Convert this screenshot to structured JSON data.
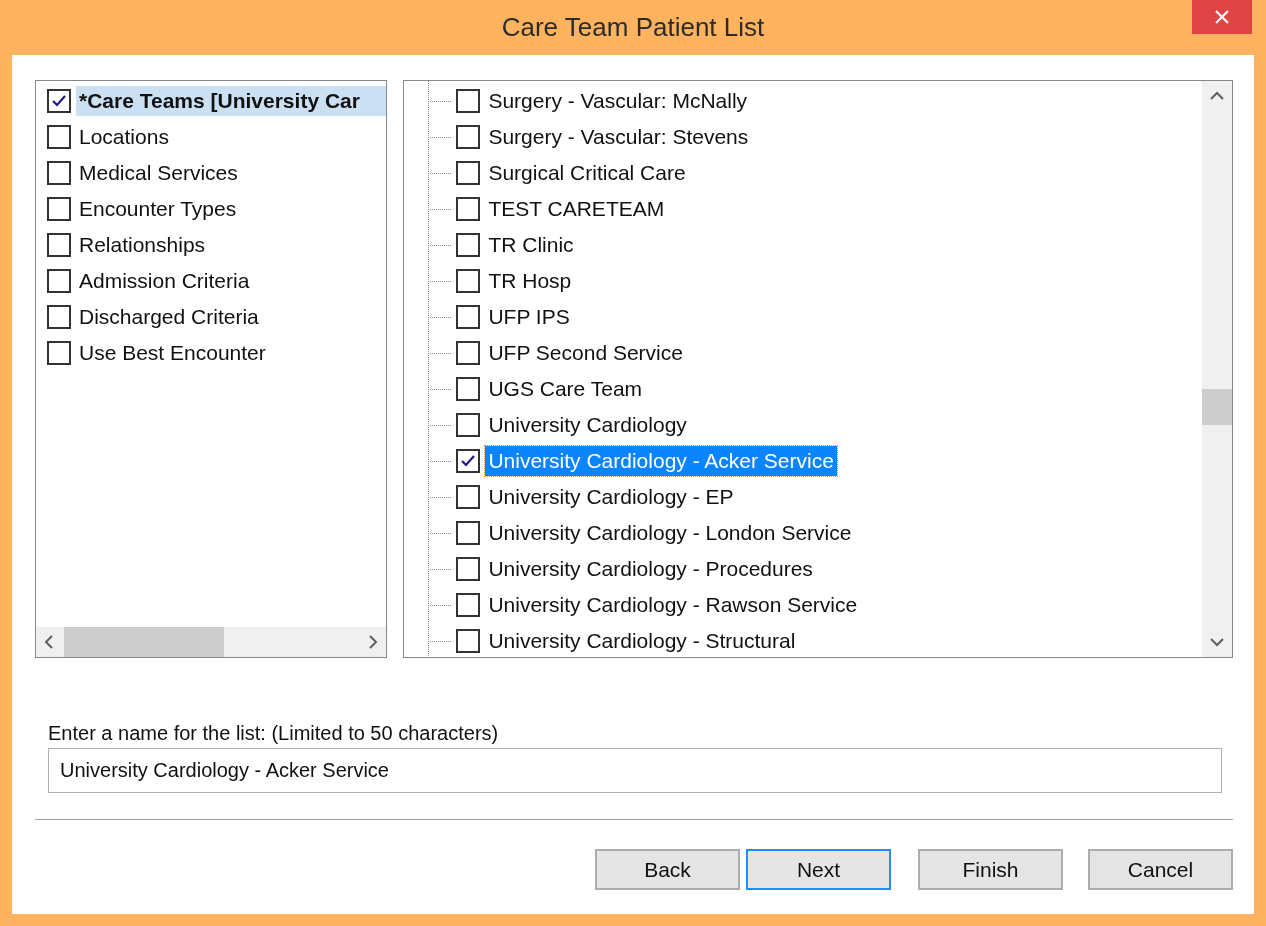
{
  "window": {
    "title": "Care Team Patient List"
  },
  "categories": [
    {
      "label": "*Care Teams [University Car",
      "checked": true,
      "selected": true,
      "bold": true
    },
    {
      "label": "Locations",
      "checked": false,
      "selected": false,
      "bold": false
    },
    {
      "label": "Medical Services",
      "checked": false,
      "selected": false,
      "bold": false
    },
    {
      "label": "Encounter Types",
      "checked": false,
      "selected": false,
      "bold": false
    },
    {
      "label": "Relationships",
      "checked": false,
      "selected": false,
      "bold": false
    },
    {
      "label": "Admission Criteria",
      "checked": false,
      "selected": false,
      "bold": false
    },
    {
      "label": "Discharged Criteria",
      "checked": false,
      "selected": false,
      "bold": false
    },
    {
      "label": "Use Best Encounter",
      "checked": false,
      "selected": false,
      "bold": false
    }
  ],
  "care_teams": [
    {
      "label": "Surgery - Vascular: McNally",
      "checked": false,
      "selected": false
    },
    {
      "label": "Surgery - Vascular: Stevens",
      "checked": false,
      "selected": false
    },
    {
      "label": "Surgical Critical Care",
      "checked": false,
      "selected": false
    },
    {
      "label": "TEST CARETEAM",
      "checked": false,
      "selected": false
    },
    {
      "label": "TR Clinic",
      "checked": false,
      "selected": false
    },
    {
      "label": "TR Hosp",
      "checked": false,
      "selected": false
    },
    {
      "label": "UFP IPS",
      "checked": false,
      "selected": false
    },
    {
      "label": "UFP Second Service",
      "checked": false,
      "selected": false
    },
    {
      "label": "UGS Care Team",
      "checked": false,
      "selected": false
    },
    {
      "label": "University Cardiology",
      "checked": false,
      "selected": false
    },
    {
      "label": "University Cardiology - Acker Service",
      "checked": true,
      "selected": true
    },
    {
      "label": "University Cardiology - EP",
      "checked": false,
      "selected": false
    },
    {
      "label": "University Cardiology - London Service",
      "checked": false,
      "selected": false
    },
    {
      "label": "University Cardiology - Procedures",
      "checked": false,
      "selected": false
    },
    {
      "label": "University Cardiology - Rawson Service",
      "checked": false,
      "selected": false
    },
    {
      "label": "University Cardiology - Structural",
      "checked": false,
      "selected": false
    }
  ],
  "name_field": {
    "label": "Enter a name for the list: (Limited to 50 characters)",
    "value": "University Cardiology - Acker Service"
  },
  "buttons": [
    {
      "label": "Back",
      "focused": false
    },
    {
      "label": "Next",
      "focused": true
    },
    {
      "label": "Finish",
      "focused": false
    },
    {
      "label": "Cancel",
      "focused": false
    }
  ]
}
